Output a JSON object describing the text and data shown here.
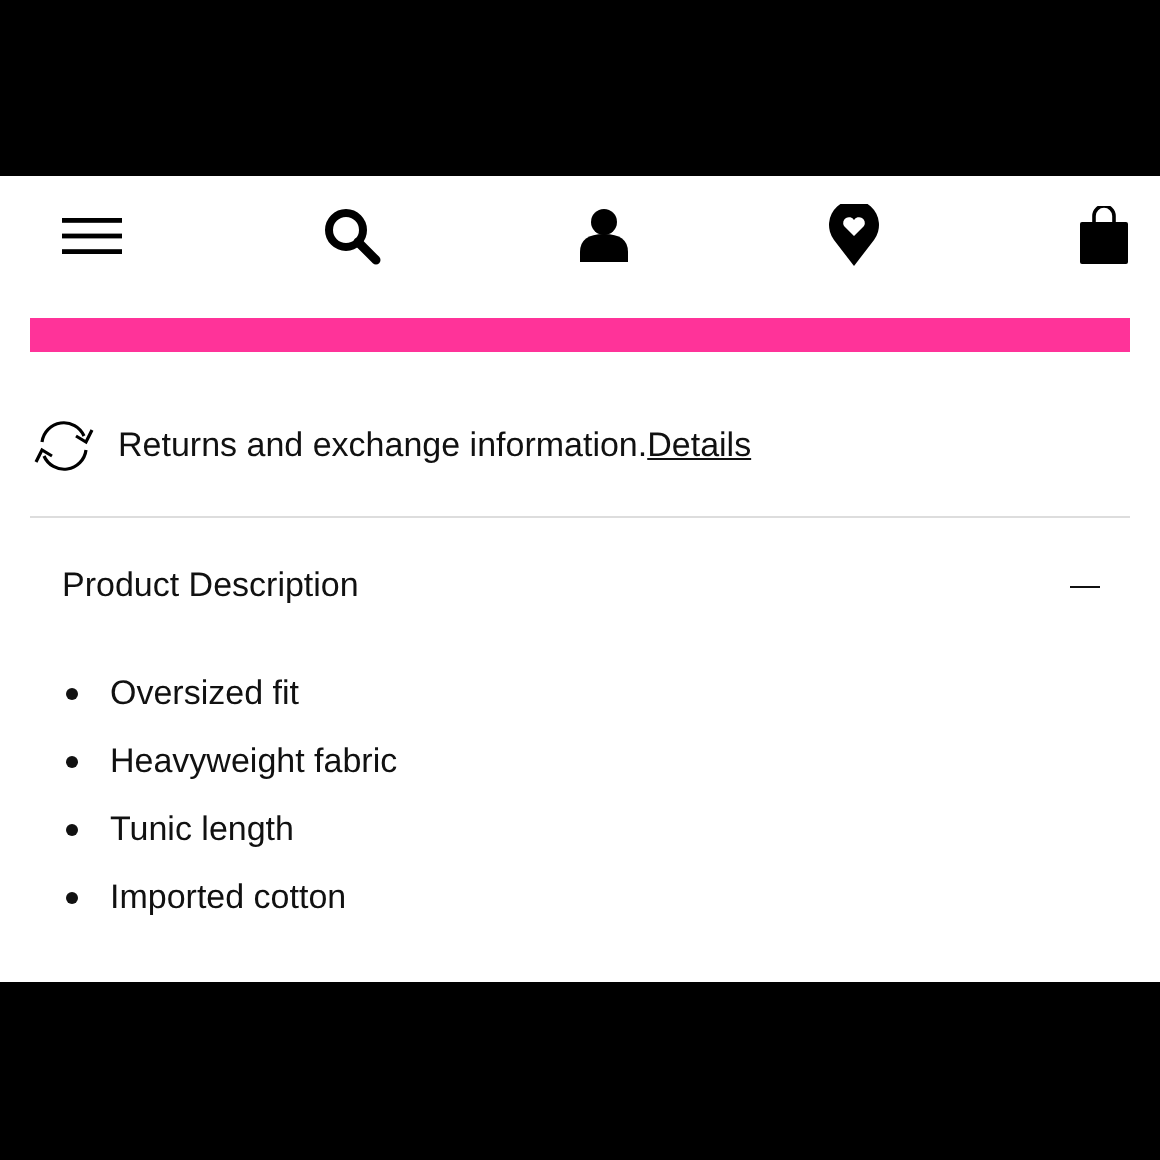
{
  "returns": {
    "text": "Returns and exchange information.",
    "link": "Details"
  },
  "section": {
    "title": "Product Description",
    "expanded": true,
    "items": [
      "Oversized fit",
      "Heavyweight fabric",
      "Tunic length",
      "Imported cotton"
    ]
  }
}
